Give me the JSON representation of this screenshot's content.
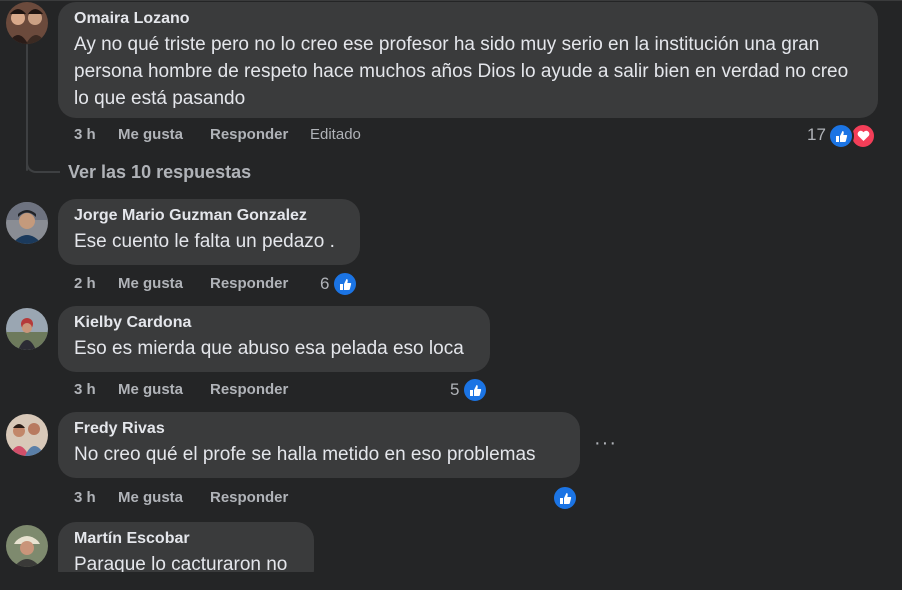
{
  "colors": {
    "background": "#242526",
    "bubble": "#3a3b3c",
    "like_blue": "#1b74e4",
    "love_red": "#f33e58",
    "muted_text": "#b0b3b8"
  },
  "comments": [
    {
      "author": "Omaira Lozano",
      "text": "Ay no qué triste pero no lo creo ese profesor ha sido muy serio en la institución una gran persona hombre de respeto hace muchos años Dios lo ayude a salir bien en verdad no creo lo que está pasando",
      "time": "3 h",
      "like": "Me gusta",
      "reply": "Responder",
      "edited": "Editado",
      "reaction_count": "17",
      "reactions": [
        "like-icon",
        "love-icon"
      ]
    },
    {
      "author": "Jorge Mario Guzman Gonzalez",
      "text": "Ese cuento le falta un pedazo .",
      "time": "2 h",
      "like": "Me gusta",
      "reply": "Responder",
      "reaction_count": "6",
      "reactions": [
        "like-icon"
      ]
    },
    {
      "author": "Kielby Cardona",
      "text": "Eso es mierda que abuso esa pelada eso loca",
      "time": "3 h",
      "like": "Me gusta",
      "reply": "Responder",
      "reaction_count": "5",
      "reactions": [
        "like-icon"
      ]
    },
    {
      "author": "Fredy Rivas",
      "text": "No creo qué el profe se halla metido en eso problemas",
      "time": "3 h",
      "like": "Me gusta",
      "reply": "Responder",
      "reactions": [
        "like-icon"
      ]
    },
    {
      "author": "Martín Escobar",
      "text": "Paraque lo cacturaron no"
    }
  ],
  "view_replies": "Ver las 10 respuestas",
  "more_options": "···"
}
